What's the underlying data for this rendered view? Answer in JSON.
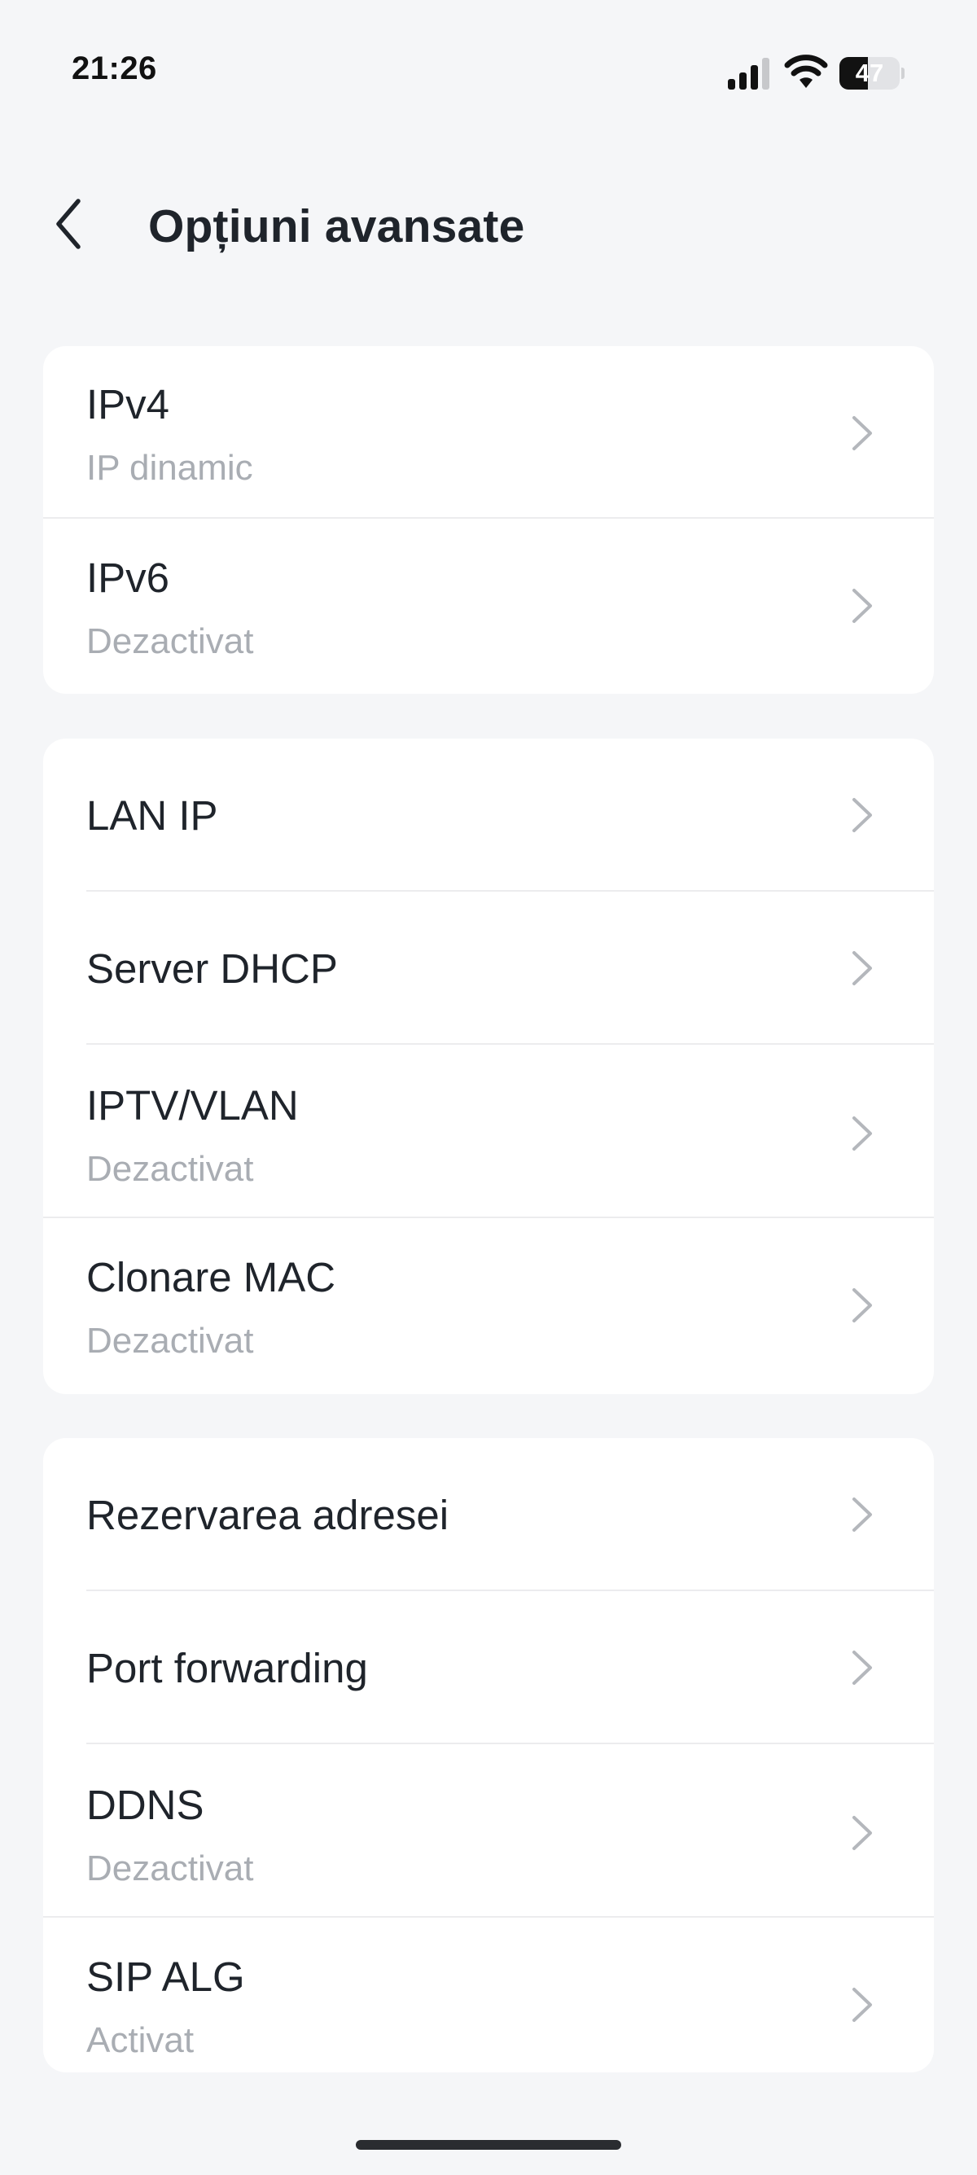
{
  "status_bar": {
    "time": "21:26",
    "battery_level": "47",
    "battery_fraction": 0.47
  },
  "header": {
    "title": "Opțiuni avansate",
    "back_icon": "chevron-left-icon"
  },
  "groups": [
    {
      "items": [
        {
          "label": "IPv4",
          "sublabel": "IP dinamic"
        },
        {
          "label": "IPv6",
          "sublabel": "Dezactivat"
        }
      ]
    },
    {
      "items": [
        {
          "label": "LAN IP"
        },
        {
          "label": "Server DHCP"
        },
        {
          "label": "IPTV/VLAN",
          "sublabel": "Dezactivat"
        },
        {
          "label": "Clonare MAC",
          "sublabel": "Dezactivat"
        }
      ]
    },
    {
      "items": [
        {
          "label": "Rezervarea adresei"
        },
        {
          "label": "Port forwarding"
        },
        {
          "label": "DDNS",
          "sublabel": "Dezactivat"
        },
        {
          "label": "SIP ALG",
          "sublabel": "Activat"
        }
      ]
    }
  ],
  "colors": {
    "background": "#f5f6f8",
    "card": "#ffffff",
    "primary_text": "#1f242b",
    "secondary_text": "#a9adb3",
    "chevron": "#b4b7bc"
  }
}
